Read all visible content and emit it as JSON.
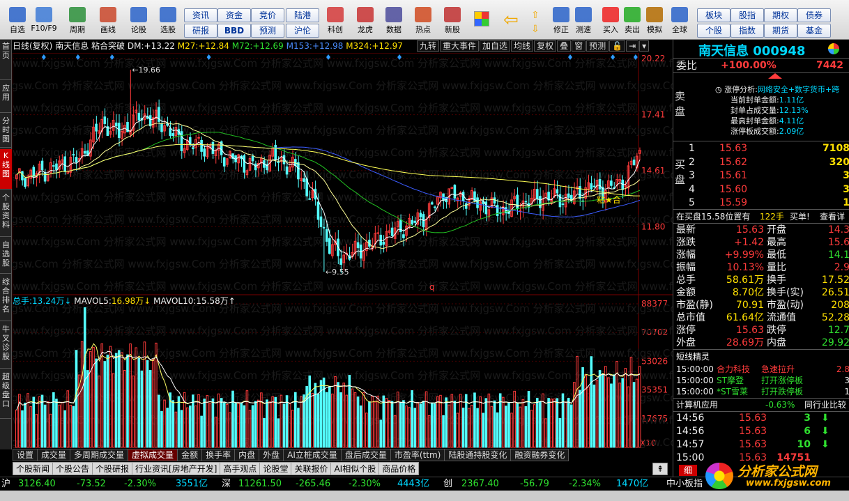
{
  "colors": {
    "up": "#ff3b3b",
    "down": "#54ffff",
    "ma27": "#ffffff",
    "ma72": "#22c022",
    "ma153": "#3b5cff",
    "ma324": "#ffff55",
    "bg": "#000000"
  },
  "toolbar": {
    "buttons": [
      {
        "label": "自选",
        "icon": "self-select-icon"
      },
      {
        "label": "F10/F9",
        "icon": "f10-icon"
      },
      {
        "label": "周期",
        "icon": "cycle-icon"
      },
      {
        "label": "画线",
        "icon": "draw-line-icon"
      },
      {
        "label": "论股",
        "icon": "discuss-icon"
      },
      {
        "label": "选股",
        "icon": "stock-pick-icon"
      },
      {
        "label": "科创",
        "icon": "sci-tech-icon"
      },
      {
        "label": "龙虎",
        "icon": "dragon-tiger-icon"
      },
      {
        "label": "数据",
        "icon": "data-icon"
      },
      {
        "label": "热点",
        "icon": "hotspot-icon"
      },
      {
        "label": "新股",
        "icon": "new-stock-icon"
      },
      {
        "label": "修正",
        "icon": "correct-icon"
      },
      {
        "label": "测速",
        "icon": "speed-test-icon"
      },
      {
        "label": "买入",
        "icon": "buy-icon"
      },
      {
        "label": "卖出",
        "icon": "sell-icon"
      },
      {
        "label": "模拟",
        "icon": "simulate-icon"
      },
      {
        "label": "全球",
        "icon": "global-icon"
      }
    ],
    "pills": [
      "资讯",
      "资金",
      "竞价",
      "陆港",
      "研报",
      "BBD",
      "预测",
      "沪伦",
      "板块",
      "股指",
      "期权",
      "债券",
      "个股",
      "指数",
      "期货",
      "基金"
    ]
  },
  "left_tabs": [
    "首页",
    "应用",
    "分时图",
    "K线图",
    "个股资料",
    "自选股",
    "综合排名",
    "牛叉诊股",
    "超级盘口"
  ],
  "chart": {
    "period": "日线(复权)",
    "stock_name": "南天信息",
    "pattern": "粘合突破",
    "dm_label": "DM:",
    "dm": "+13.22",
    "ma27_label": "M27:",
    "ma27": "+12.84",
    "ma72_label": "M72:",
    "ma72": "+12.69",
    "ma153_label": "M153:",
    "ma153": "+12.98",
    "ma324_label": "M324:",
    "ma324": "+12.97",
    "buttons": [
      "九转",
      "重大事件",
      "加自选",
      "均线",
      "复权",
      "叠",
      "窗",
      "预测"
    ],
    "price_axis": [
      "20.22",
      "17.41",
      "14.61",
      "11.80"
    ],
    "annotations": {
      "high": "19.66",
      "low": "9.55",
      "pattern_label": "粘★合",
      "marker": "q"
    },
    "volume_axis": [
      "88377",
      "70702",
      "53026",
      "35351",
      "17675"
    ],
    "unit": "X10",
    "vol_label": "总手:",
    "vol_total": "13.24万↓",
    "mavol5_label": "MAVOL5:",
    "mavol5": "16.98万↓",
    "mavol10_label": "MAVOL10:",
    "mavol10": "15.58万↑"
  },
  "chart_data": {
    "type": "candlestick",
    "ylim": [
      8.5,
      20.5
    ],
    "last_close": 15.63,
    "high_marked": 19.66,
    "low_marked": 9.55,
    "volume_ylim": [
      0,
      88377
    ]
  },
  "bottom_tabs": [
    "设置",
    "成交量",
    "多周期成交量",
    "虚拟成交量",
    "金额",
    "换手率",
    "内盘",
    "外盘",
    "AI立桩成交量",
    "盘后成交量",
    "市盈率(ttm)",
    "陆股通持股变化",
    "融资融券变化"
  ],
  "news_tabs": [
    "个股新闻",
    "个股公告",
    "个股研报",
    "行业资讯[房地产开发]",
    "高手观点",
    "论股堂",
    "关联报价",
    "AI相似个股",
    "商品价格"
  ],
  "ticker": {
    "sh_label": "沪",
    "sh": "3126.40",
    "sh_chg": "-73.52",
    "sh_pct": "-2.30%",
    "sh_amt": "3551亿",
    "sz_label": "深",
    "sz": "11261.50",
    "sz_chg": "-265.46",
    "sz_pct": "-2.30%",
    "sz_amt": "4443亿",
    "cy_label": "创",
    "cy": "2367.40",
    "cy_chg": "-56.79",
    "cy_pct": "-2.34%",
    "cy_amt": "1470亿",
    "board": "中小板指"
  },
  "panel": {
    "name": "南天信息",
    "code": "000948",
    "weibi_label": "委比",
    "weibi": "+100.00%",
    "weicha": "7442",
    "sell_label": "卖盘",
    "limit_analysis": "涨停分析:",
    "limit_tags": "网络安全+数字货币+跨",
    "limit_lines": [
      {
        "label": "当前封单金额:",
        "value": "1.11亿"
      },
      {
        "label": "封单占成交量:",
        "value": "12.13%"
      },
      {
        "label": "最高封单金额:",
        "value": "4.11亿"
      },
      {
        "label": "涨停板成交额:",
        "value": "2.09亿"
      }
    ],
    "buy_label": "买盘",
    "bids": [
      {
        "lvl": "1",
        "price": "15.63",
        "vol": "7108"
      },
      {
        "lvl": "2",
        "price": "15.62",
        "vol": "320"
      },
      {
        "lvl": "3",
        "price": "15.61",
        "vol": "3"
      },
      {
        "lvl": "4",
        "price": "15.60",
        "vol": "3"
      },
      {
        "lvl": "5",
        "price": "15.59",
        "vol": "1"
      }
    ],
    "position_note": "在买盘15.58位置有",
    "position_qty": "122手",
    "position_side": "买单!",
    "view_detail": "查看详",
    "quote": [
      {
        "l1": "最新",
        "v1": "15.63",
        "l2": "开盘",
        "v2": "14.3"
      },
      {
        "l1": "涨跌",
        "v1": "+1.42",
        "l2": "最高",
        "v2": "15.6"
      },
      {
        "l1": "涨幅",
        "v1": "+9.99%",
        "l2": "最低",
        "v2": "14.1"
      },
      {
        "l1": "振幅",
        "v1": "10.13%",
        "l2": "量比",
        "v2": "2.9"
      },
      {
        "l1": "总手",
        "v1": "58.61万",
        "l2": "换手",
        "v2": "17.52"
      },
      {
        "l1": "金额",
        "v1": "8.70亿",
        "l2": "换手(实)",
        "v2": "26.51"
      },
      {
        "l1": "市盈(静)",
        "v1": "70.91",
        "l2": "市盈(动)",
        "v2": "208"
      },
      {
        "l1": "总市值",
        "v1": "61.64亿",
        "l2": "流通值",
        "v2": "52.28"
      },
      {
        "l1": "涨停",
        "v1": "15.63",
        "l2": "跌停",
        "v2": "12.7"
      },
      {
        "l1": "外盘",
        "v1": "28.69万",
        "l2": "内盘",
        "v2": "29.92"
      }
    ],
    "short_title": "短线精灵",
    "short_items": [
      {
        "time": "15:00:00",
        "name": "合力科技",
        "event": "急速拉升",
        "val": "2.8"
      },
      {
        "time": "15:00:00",
        "name": "ST摩登",
        "event": "打开涨停板",
        "val": "3"
      },
      {
        "time": "15:00:00",
        "name": "*ST雪莱",
        "event": "打开跌停板",
        "val": "1"
      }
    ],
    "industry": "计算机应用",
    "industry_pct": "-0.63%",
    "industry_cmp": "同行业比较",
    "trades": [
      {
        "time": "14:56",
        "price": "15.63",
        "vol": "3"
      },
      {
        "time": "14:56",
        "price": "15.63",
        "vol": "6"
      },
      {
        "time": "14:57",
        "price": "15.63",
        "vol": "10"
      },
      {
        "time": "15:00",
        "price": "15.63",
        "vol": "14751"
      }
    ],
    "detail_tab": "细"
  },
  "watermark": {
    "brand": "分析家公式网",
    "url": "www.fxjgsw.com"
  }
}
